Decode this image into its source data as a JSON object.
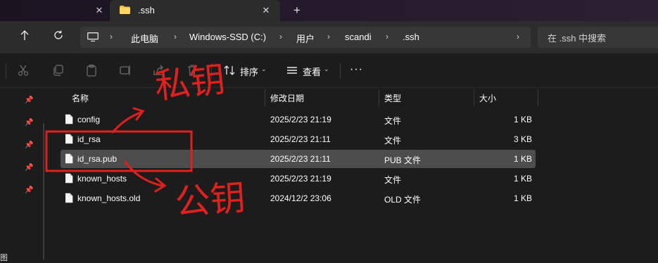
{
  "window": {
    "tab_title": ".ssh",
    "new_tab": "+",
    "close_glyph": "✕"
  },
  "address": {
    "crumbs": [
      "此电脑",
      "Windows-SSD (C:)",
      "用户",
      "scandi",
      ".ssh"
    ],
    "separator": "›",
    "search_placeholder": "在 .ssh 中搜索"
  },
  "toolbar": {
    "sort_label": "排序",
    "view_label": "查看",
    "more_label": "···",
    "chevron": "⌄"
  },
  "columns": {
    "name": "名称",
    "modified": "修改日期",
    "type": "类型",
    "size": "大小"
  },
  "files": [
    {
      "name": "config",
      "modified": "2025/2/23 21:19",
      "type": "文件",
      "size": "1 KB",
      "selected": false
    },
    {
      "name": "id_rsa",
      "modified": "2025/2/23 21:11",
      "type": "文件",
      "size": "3 KB",
      "selected": false
    },
    {
      "name": "id_rsa.pub",
      "modified": "2025/2/23 21:11",
      "type": "PUB 文件",
      "size": "1 KB",
      "selected": true
    },
    {
      "name": "known_hosts",
      "modified": "2025/2/23 21:19",
      "type": "文件",
      "size": "1 KB",
      "selected": false
    },
    {
      "name": "known_hosts.old",
      "modified": "2024/12/2 23:06",
      "type": "OLD 文件",
      "size": "1 KB",
      "selected": false
    }
  ],
  "leftnav": {
    "partial_label": "图"
  },
  "annotations": {
    "private_key_label": "私钥",
    "public_key_label": "公钥",
    "color": "#e0201c"
  },
  "colors": {
    "background": "#1c1c1c",
    "selected_row": "#4d4d4d",
    "folder_yellow": "#f3c244"
  }
}
